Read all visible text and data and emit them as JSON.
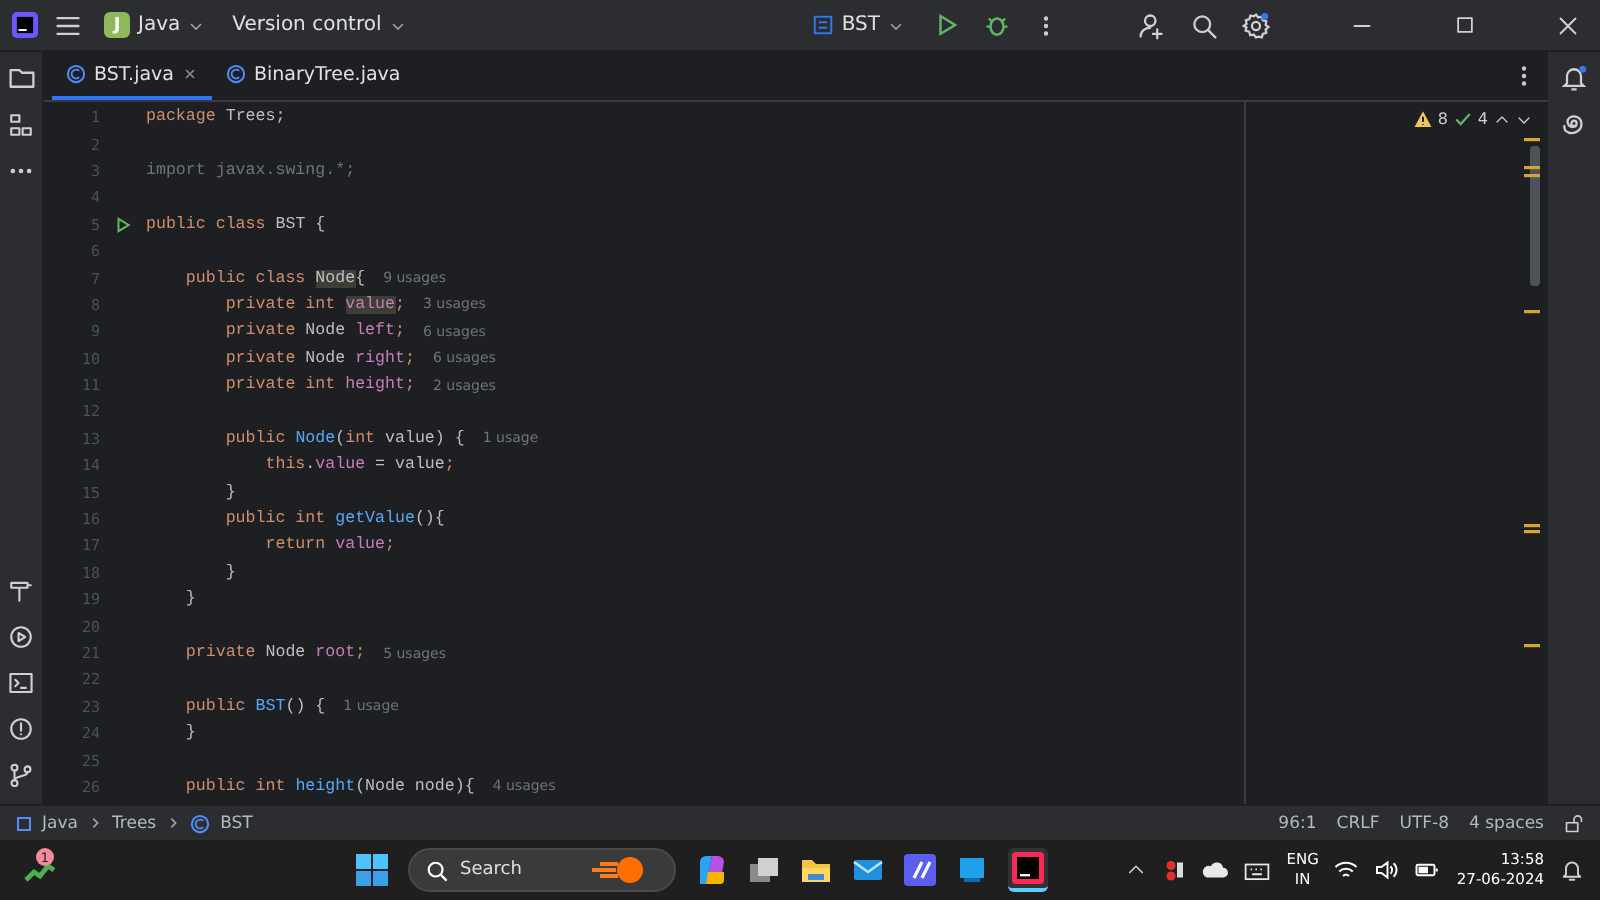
{
  "title_bar": {
    "project_badge": "J",
    "project": "Java",
    "vcs": "Version control",
    "run_config": "BST"
  },
  "tabs": [
    {
      "label": "BST.java",
      "selected": true,
      "closable": true
    },
    {
      "label": "BinaryTree.java",
      "selected": false,
      "closable": false
    }
  ],
  "inspections": {
    "warnings": "8",
    "weak_warnings": "4"
  },
  "code_lines": [
    {
      "number": "1",
      "tokens": [
        {
          "kind": "kw",
          "text": "package "
        },
        {
          "kind": "plain",
          "text": "Trees;"
        }
      ]
    },
    {
      "number": "2"
    },
    {
      "number": "3",
      "tokens": [
        {
          "kind": "unused",
          "text": "import javax.swing.*;"
        }
      ]
    },
    {
      "number": "4"
    },
    {
      "number": "5",
      "run": true,
      "tokens": [
        {
          "kind": "kw",
          "text": "public class "
        },
        {
          "kind": "plain",
          "text": "BST {"
        }
      ]
    },
    {
      "number": "6"
    },
    {
      "number": "7",
      "tokens": [
        {
          "kind": "kw",
          "text": "    public class "
        },
        {
          "kind": "plain",
          "text": "Node",
          "highlighted": true
        },
        {
          "kind": "plain",
          "text": "{"
        }
      ],
      "hint": "9 usages"
    },
    {
      "number": "8",
      "tokens": [
        {
          "kind": "kw",
          "text": "        private int "
        },
        {
          "kind": "field",
          "text": "value",
          "highlighted": true
        },
        {
          "kind": "kw",
          "text": ";"
        }
      ],
      "hint": "3 usages"
    },
    {
      "number": "9",
      "tokens": [
        {
          "kind": "kw",
          "text": "        private "
        },
        {
          "kind": "plain",
          "text": "Node "
        },
        {
          "kind": "field",
          "text": "left"
        },
        {
          "kind": "kw",
          "text": ";"
        }
      ],
      "hint": "6 usages"
    },
    {
      "number": "10",
      "tokens": [
        {
          "kind": "kw",
          "text": "        private "
        },
        {
          "kind": "plain",
          "text": "Node "
        },
        {
          "kind": "field",
          "text": "right"
        },
        {
          "kind": "kw",
          "text": ";"
        }
      ],
      "hint": "6 usages"
    },
    {
      "number": "11",
      "tokens": [
        {
          "kind": "kw",
          "text": "        private int "
        },
        {
          "kind": "field",
          "text": "height"
        },
        {
          "kind": "kw",
          "text": ";"
        }
      ],
      "hint": "2 usages"
    },
    {
      "number": "12"
    },
    {
      "number": "13",
      "tokens": [
        {
          "kind": "kw",
          "text": "        public "
        },
        {
          "kind": "fn",
          "text": "Node"
        },
        {
          "kind": "plain",
          "text": "("
        },
        {
          "kind": "kw",
          "text": "int "
        },
        {
          "kind": "plain",
          "text": "value) {"
        }
      ],
      "hint": "1 usage"
    },
    {
      "number": "14",
      "tokens": [
        {
          "kind": "kw",
          "text": "            this"
        },
        {
          "kind": "plain",
          "text": "."
        },
        {
          "kind": "field",
          "text": "value"
        },
        {
          "kind": "plain",
          "text": " = value"
        },
        {
          "kind": "kw",
          "text": ";"
        }
      ]
    },
    {
      "number": "15",
      "tokens": [
        {
          "kind": "plain",
          "text": "        }"
        }
      ]
    },
    {
      "number": "16",
      "tokens": [
        {
          "kind": "kw",
          "text": "        public int "
        },
        {
          "kind": "fn",
          "text": "getValue"
        },
        {
          "kind": "plain",
          "text": "(){"
        }
      ]
    },
    {
      "number": "17",
      "tokens": [
        {
          "kind": "kw",
          "text": "            return "
        },
        {
          "kind": "field",
          "text": "value"
        },
        {
          "kind": "kw",
          "text": ";"
        }
      ]
    },
    {
      "number": "18",
      "tokens": [
        {
          "kind": "plain",
          "text": "        }"
        }
      ]
    },
    {
      "number": "19",
      "tokens": [
        {
          "kind": "plain",
          "text": "    }"
        }
      ]
    },
    {
      "number": "20"
    },
    {
      "number": "21",
      "tokens": [
        {
          "kind": "kw",
          "text": "    private "
        },
        {
          "kind": "plain",
          "text": "Node "
        },
        {
          "kind": "field",
          "text": "root"
        },
        {
          "kind": "kw",
          "text": ";"
        }
      ],
      "hint": "5 usages"
    },
    {
      "number": "22"
    },
    {
      "number": "23",
      "tokens": [
        {
          "kind": "kw",
          "text": "    public "
        },
        {
          "kind": "fn",
          "text": "BST"
        },
        {
          "kind": "plain",
          "text": "() {"
        }
      ],
      "hint": "1 usage"
    },
    {
      "number": "24",
      "tokens": [
        {
          "kind": "plain",
          "text": "    }"
        }
      ]
    },
    {
      "number": "25"
    },
    {
      "number": "26",
      "tokens": [
        {
          "kind": "kw",
          "text": "    public int "
        },
        {
          "kind": "fn",
          "text": "height"
        },
        {
          "kind": "plain",
          "text": "(Node node){"
        }
      ],
      "hint": "4 usages"
    }
  ],
  "breadcrumbs": [
    "Java",
    "Trees",
    "BST"
  ],
  "status_bar": {
    "position": "96:1",
    "line_separator": "CRLF",
    "encoding": "UTF-8",
    "indent": "4 spaces"
  },
  "taskbar": {
    "widget_badge": "1",
    "search": {
      "placeholder": "Search"
    },
    "language": "ENG",
    "region": "IN",
    "time": "13:58",
    "date": "27-06-2024"
  }
}
